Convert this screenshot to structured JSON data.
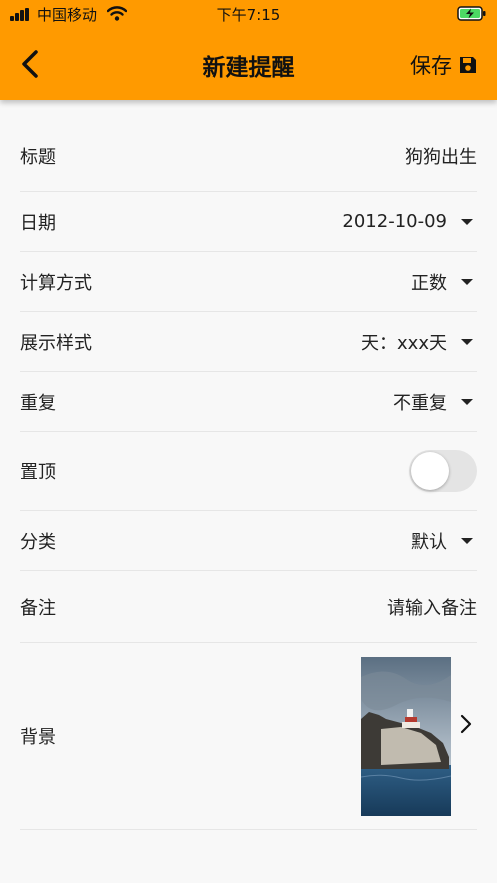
{
  "status_bar": {
    "carrier": "中国移动",
    "time": "下午7:15"
  },
  "header": {
    "title": "新建提醒",
    "save_label": "保存",
    "back_icon": "chevron-left-icon",
    "save_icon": "floppy-disk-icon",
    "background_color": "#ff9a00"
  },
  "form": {
    "title": {
      "label": "标题",
      "value": "狗狗出生"
    },
    "date": {
      "label": "日期",
      "value": "2012-10-09"
    },
    "calc_method": {
      "label": "计算方式",
      "value": "正数"
    },
    "display_style": {
      "label": "展示样式",
      "value": "天：xxx天"
    },
    "repeat": {
      "label": "重复",
      "value": "不重复"
    },
    "pin_top": {
      "label": "置顶",
      "enabled": false
    },
    "category": {
      "label": "分类",
      "value": "默认"
    },
    "note": {
      "label": "备注",
      "placeholder": "请输入备注"
    },
    "background": {
      "label": "背景",
      "thumbnail": "lighthouse-on-rocky-cliff-by-sea"
    }
  }
}
